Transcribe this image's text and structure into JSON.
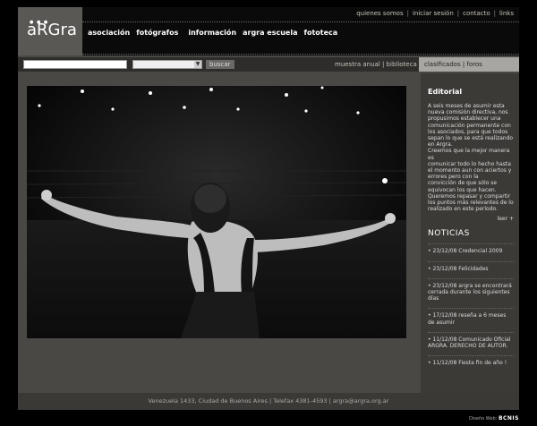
{
  "logo": {
    "text": "aRGra"
  },
  "top_links": [
    "quienes somos",
    "iniciar sesión",
    "contacto",
    "links"
  ],
  "main_nav": [
    "asociación",
    "fotógrafos",
    "información",
    "argra escuela",
    "fototeca"
  ],
  "search": {
    "button_label": "buscar",
    "input_value": "",
    "select_value": ""
  },
  "search_links": "muestra anual | biblioteca",
  "side_tabs": "clasificados | foros",
  "editorial": {
    "heading": "Editorial",
    "text": "      A seis meses de asumir esta nueva comisión directiva, nos propusimos establecer una comunicación permanente con los asociados, para que todos sepan lo que se está realizando en Argra.\nCreemos que la mejor manera es\ncomunicar todo lo hecho hasta el momento aun con aciertos y errores pero con la\nconvicción de que sólo se equivocan los que hacen.\nQueremos repasar y compartir\nlos puntos más relevantes de lo realizado en este período.",
    "readmore": "leer +"
  },
  "noticias": {
    "heading": "NOTICIAS",
    "items": [
      "• 23/12/08 Credencial 2009",
      "• 23/12/08 Felicidades",
      "• 23/12/08 argra se encontrará cerrada durante los siguientes días",
      "• 17/12/08 reseña a 6 meses de asumir",
      "• 11/12/08 Comunicado Oficial ARGRA. DERECHO DE AUTOR.",
      "• 11/12/08 Fiesta fin de año !"
    ]
  },
  "footer": {
    "text": "Venezuela 1433, Ciudad de Buenos Aires   |   Telefax 4381-4593   |   argra@argra.org.ar"
  },
  "credit": {
    "label": "Diseño Web:",
    "name": "BCNIS"
  }
}
